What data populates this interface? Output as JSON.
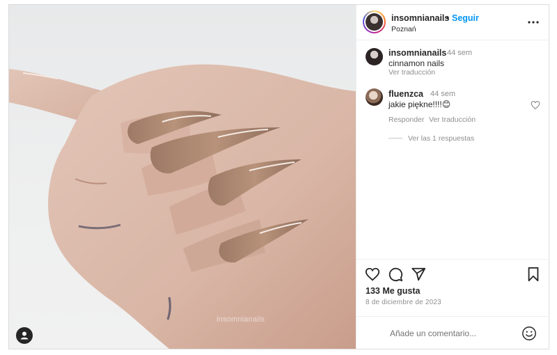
{
  "post": {
    "author": "insomnianails",
    "separator": "•",
    "follow_label": "Seguir",
    "location": "Poznań",
    "more_label": "•••",
    "watermark": "insomnianails"
  },
  "caption": {
    "username": "insomnianails",
    "time": "44 sem",
    "text": "cinnamon nails",
    "translate": "Ver traducción"
  },
  "comments": [
    {
      "username": "fluenzca",
      "time": "44 sem",
      "text": "jakie piękne!!!!😊",
      "reply": "Responder",
      "translate": "Ver traducción",
      "view_replies": "Ver las 1 respuestas"
    }
  ],
  "actions": {
    "likes": "133 Me gusta",
    "date": "8 de diciembre de 2023"
  },
  "comment_box": {
    "placeholder": "Añade un comentario..."
  },
  "icons": [
    "heart-icon",
    "comment-icon",
    "share-icon",
    "bookmark-icon",
    "emoji-icon",
    "more-icon",
    "user-tag-icon"
  ]
}
